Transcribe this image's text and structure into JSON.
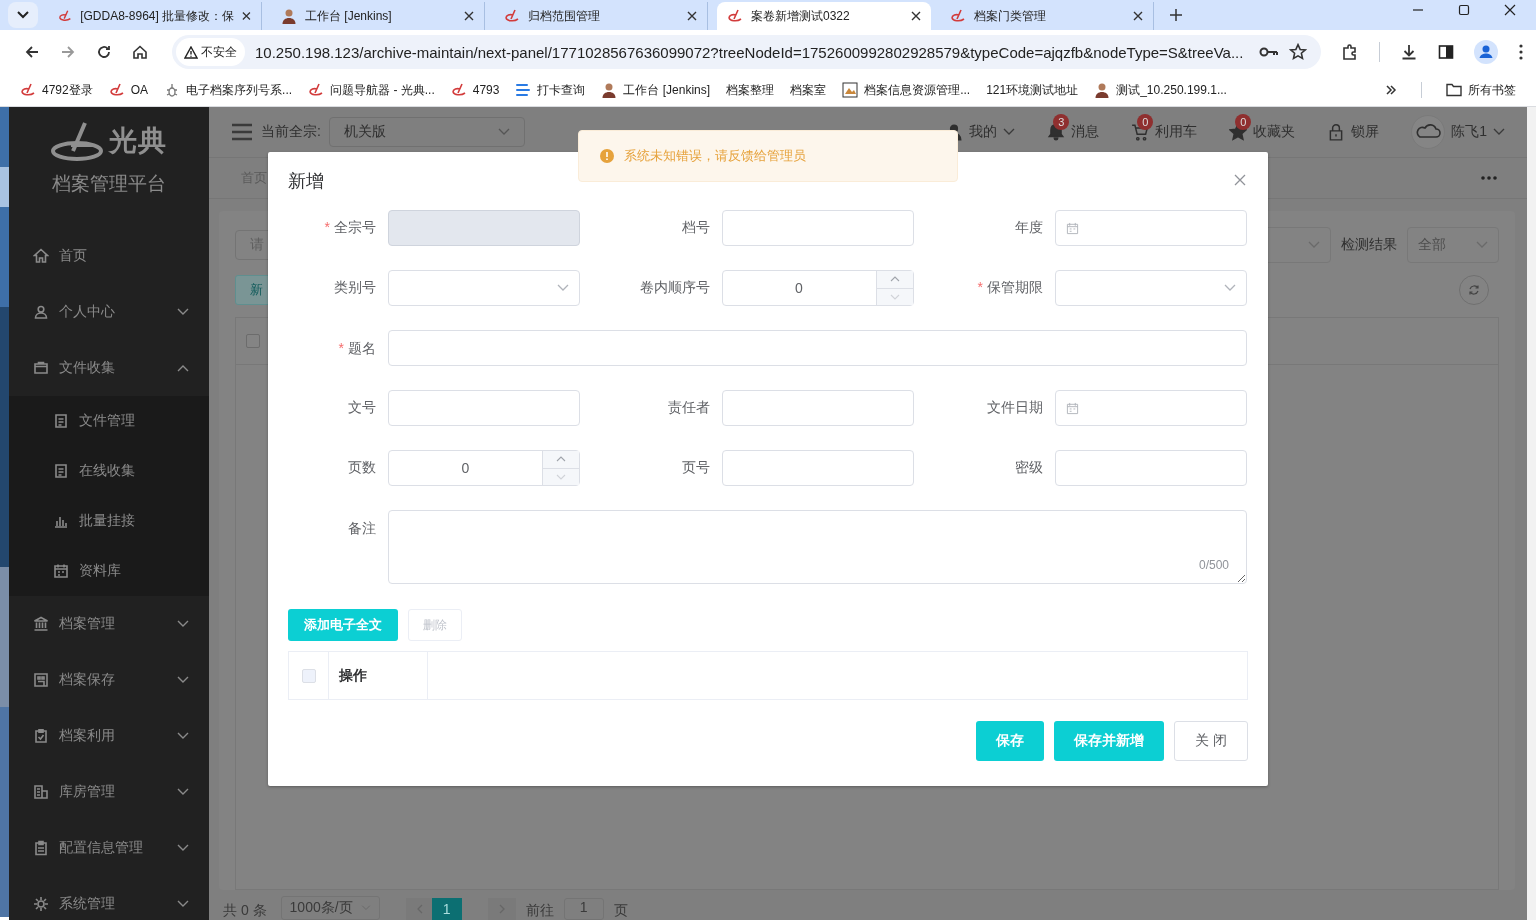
{
  "browser": {
    "tabs": [
      {
        "title": "[GDDA8-8964] 批量修改：保",
        "selected": false
      },
      {
        "title": "工作台 [Jenkins]",
        "selected": false
      },
      {
        "title": "归档范围管理",
        "selected": false
      },
      {
        "title": "案卷新增测试0322",
        "selected": true
      },
      {
        "title": "档案门类管理",
        "selected": false
      }
    ],
    "security_label": "不安全",
    "url": "10.250.198.123/archive-maintain/next-panel/1771028567636099072?treeNodeId=1752600992802928579&typeCode=ajqzfb&nodeType=S&treeVa...",
    "bookmarks": [
      "4792登录",
      "OA",
      "电子档案序列号系...",
      "问题导航器 - 光典...",
      "4793",
      "打卡查询",
      "工作台 [Jenkins]",
      "档案整理",
      "档案室",
      "档案信息资源管理...",
      "121环境测试地址",
      "测试_10.250.199.1..."
    ],
    "all_bookmarks": "所有书签"
  },
  "sidebar": {
    "logo_text": "光典",
    "platform_name": "档案管理平台",
    "menu": [
      {
        "label": "首页",
        "kind": "link"
      },
      {
        "label": "个人中心",
        "kind": "group",
        "expanded": false
      },
      {
        "label": "文件收集",
        "kind": "group",
        "expanded": true,
        "children": [
          {
            "label": "文件管理"
          },
          {
            "label": "在线收集"
          },
          {
            "label": "批量挂接"
          },
          {
            "label": "资料库"
          }
        ]
      },
      {
        "label": "档案管理",
        "kind": "group",
        "expanded": false
      },
      {
        "label": "档案保存",
        "kind": "group",
        "expanded": false
      },
      {
        "label": "档案利用",
        "kind": "group",
        "expanded": false
      },
      {
        "label": "库房管理",
        "kind": "group",
        "expanded": false
      },
      {
        "label": "配置信息管理",
        "kind": "group",
        "expanded": false
      },
      {
        "label": "系统管理",
        "kind": "group",
        "expanded": false
      }
    ]
  },
  "header": {
    "fonds_label": "当前全宗:",
    "fonds_value": "机关版",
    "items": [
      {
        "label": "我的",
        "kind": "dropdown"
      },
      {
        "label": "消息",
        "kind": "badge",
        "badge": "3"
      },
      {
        "label": "利用车",
        "kind": "badge",
        "badge": "0"
      },
      {
        "label": "收藏夹",
        "kind": "badge",
        "badge": "0"
      },
      {
        "label": "锁屏",
        "kind": "plain"
      }
    ],
    "user": "陈飞1"
  },
  "page_tabs": [
    "首页"
  ],
  "list_page": {
    "search_placeholder": "请",
    "add_button": "新",
    "result_label": "检测结果",
    "result_value": "全部",
    "select_all_checked": false,
    "pagination": {
      "total": "共 0 条",
      "page_size": "1000条/页",
      "pages": [
        {
          "label": "1",
          "selected": true
        }
      ],
      "goto_label": "前往",
      "goto_value": "1",
      "page_unit": "页"
    }
  },
  "toast": {
    "message": "系统未知错误，请反馈给管理员"
  },
  "dialog": {
    "title": "新增",
    "required_mark": "*",
    "fields": [
      {
        "label": "全宗号",
        "kind": "text",
        "required": true,
        "disabled": true,
        "wide": false
      },
      {
        "label": "档号",
        "kind": "text",
        "required": false,
        "disabled": false,
        "wide": false
      },
      {
        "label": "年度",
        "kind": "date",
        "required": false,
        "disabled": false,
        "wide": false
      },
      {
        "label": "类别号",
        "kind": "select",
        "required": false,
        "disabled": false,
        "wide": false
      },
      {
        "label": "卷内顺序号",
        "kind": "number",
        "value": "0",
        "required": false,
        "disabled": false,
        "wide": false
      },
      {
        "label": "保管期限",
        "kind": "select",
        "required": true,
        "disabled": false,
        "wide": false
      },
      {
        "label": "题名",
        "kind": "text",
        "required": true,
        "disabled": false,
        "wide": true
      },
      {
        "label": "文号",
        "kind": "text",
        "required": false,
        "disabled": false,
        "wide": false
      },
      {
        "label": "责任者",
        "kind": "text",
        "required": false,
        "disabled": false,
        "wide": false
      },
      {
        "label": "文件日期",
        "kind": "date",
        "required": false,
        "disabled": false,
        "wide": false
      },
      {
        "label": "页数",
        "kind": "number",
        "value": "0",
        "required": false,
        "disabled": false,
        "wide": false
      },
      {
        "label": "页号",
        "kind": "text",
        "required": false,
        "disabled": false,
        "wide": false
      },
      {
        "label": "密级",
        "kind": "text",
        "required": false,
        "disabled": false,
        "wide": false
      },
      {
        "label": "备注",
        "kind": "textarea",
        "counter": "0/500",
        "required": false,
        "disabled": false,
        "wide": true
      }
    ],
    "attach_button": "添加电子全文",
    "delete_button": {
      "label": "删除",
      "disabled": true
    },
    "table": {
      "select_all_checked": false,
      "columns": [
        "操作"
      ]
    },
    "footer_buttons": [
      {
        "label": "保存",
        "kind": "primary"
      },
      {
        "label": "保存并新增",
        "kind": "primary"
      },
      {
        "label": "关 闭",
        "kind": "plain"
      }
    ]
  }
}
